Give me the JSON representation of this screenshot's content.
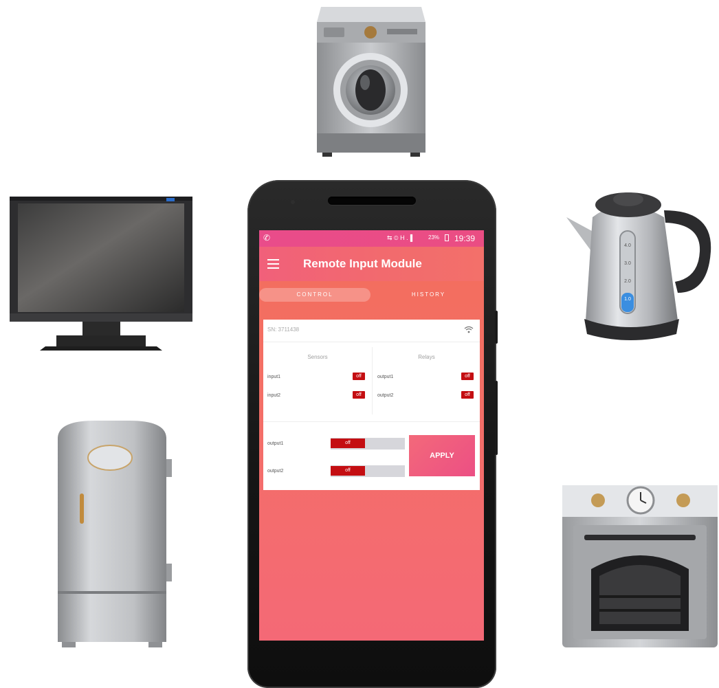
{
  "status_bar": {
    "indicators": "⇆ ⦶ H .▐",
    "battery": "23%",
    "time": "19:39"
  },
  "app": {
    "title": "Remote Input Module",
    "menu_icon": "hamburger-icon"
  },
  "tabs": [
    {
      "label": "CONTROL",
      "active": true
    },
    {
      "label": "HISTORY",
      "active": false
    }
  ],
  "device": {
    "serial": "SN: 3711438",
    "wifi_icon": "wifi-icon"
  },
  "sensors": {
    "header": "Sensors",
    "rows": [
      {
        "name": "input1",
        "state": "off"
      },
      {
        "name": "input2",
        "state": "off"
      }
    ]
  },
  "relays": {
    "header": "Relays",
    "rows": [
      {
        "name": "output1",
        "state": "off"
      },
      {
        "name": "output2",
        "state": "off"
      }
    ]
  },
  "controls": {
    "rows": [
      {
        "name": "output1",
        "state": "off"
      },
      {
        "name": "output2",
        "state": "off"
      }
    ],
    "apply_label": "APPLY"
  },
  "colors": {
    "accent_pink": "#ec4f84",
    "accent_coral": "#f36e5c",
    "off_red": "#c40e12"
  },
  "illustrations": [
    "washing-machine",
    "monitor",
    "kettle",
    "refrigerator",
    "oven"
  ],
  "kettle_scale": [
    "4.0",
    "3.0",
    "2.0",
    "1.0"
  ]
}
